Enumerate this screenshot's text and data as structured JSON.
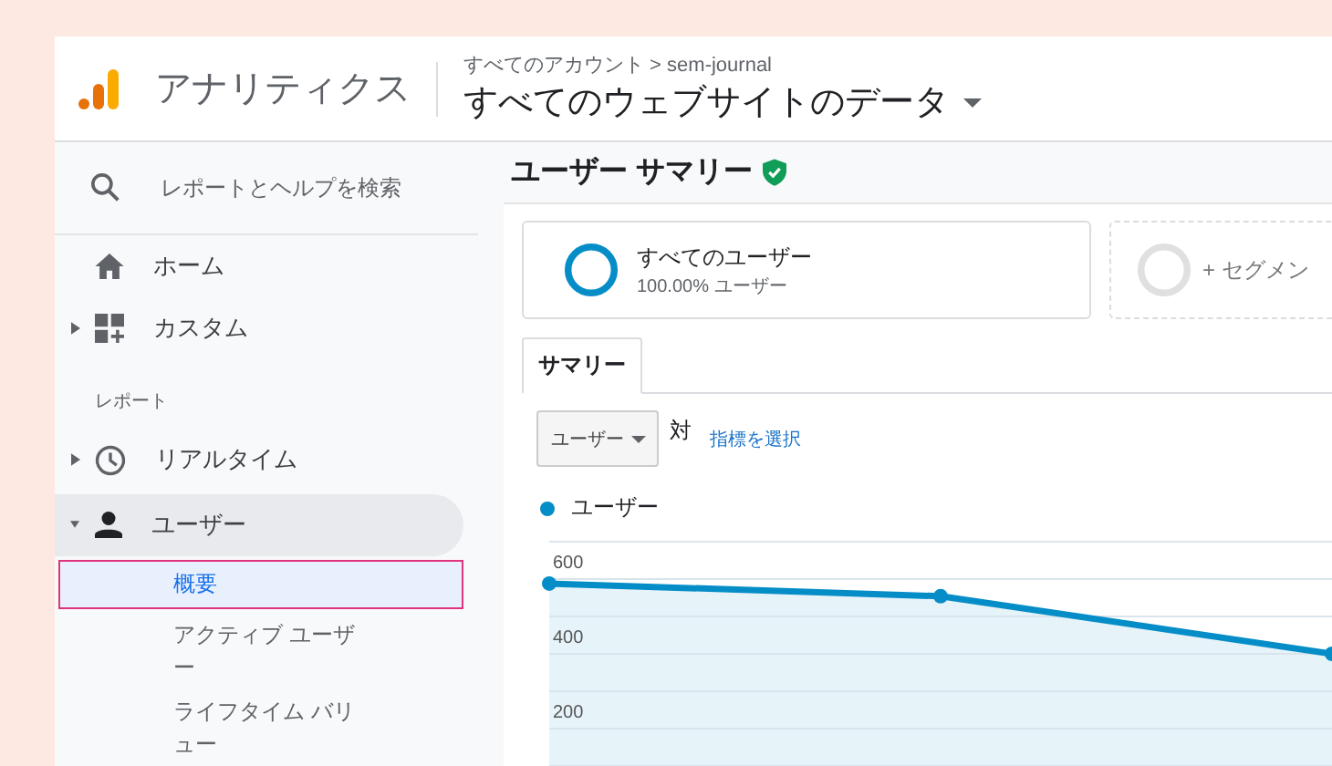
{
  "header": {
    "product": "アナリティクス",
    "breadcrumb": "すべてのアカウント > sem-journal",
    "view": "すべてのウェブサイトのデータ"
  },
  "sidebar": {
    "search": {
      "placeholder": "レポートとヘルプを検索"
    },
    "top_items": [
      {
        "label": "ホーム"
      },
      {
        "label": "カスタム",
        "expanded": false
      }
    ],
    "section_label": "レポート",
    "report_items": [
      {
        "label": "リアルタイム",
        "expanded": false,
        "selected": false
      },
      {
        "label": "ユーザー",
        "expanded": true,
        "selected": true,
        "children": [
          {
            "label": "概要",
            "selected": true
          },
          {
            "label": "アクティブ ユーザー",
            "selected": false
          },
          {
            "label": "ライフタイム バリュー",
            "selected": false
          }
        ]
      }
    ]
  },
  "main": {
    "title": "ユーザー サマリー",
    "verified": true,
    "segments": [
      {
        "kind": "active",
        "name": "すべてのユーザー",
        "detail": "100.00% ユーザー"
      },
      {
        "kind": "add",
        "name": "+ セグメン"
      }
    ],
    "tabs": [
      {
        "label": "サマリー",
        "selected": true
      }
    ],
    "metric_select": {
      "value": "ユーザー"
    },
    "versus": "対",
    "compare_link": "指標を選択",
    "chart_data": {
      "type": "area",
      "series": [
        {
          "name": "ユーザー",
          "color": "#058dc7",
          "values": [
            588,
            554,
            400
          ]
        }
      ],
      "categories": [
        null,
        null,
        null
      ],
      "ylim": [
        0,
        700
      ],
      "grid": true,
      "yticks": [
        200,
        400,
        600
      ]
    }
  }
}
